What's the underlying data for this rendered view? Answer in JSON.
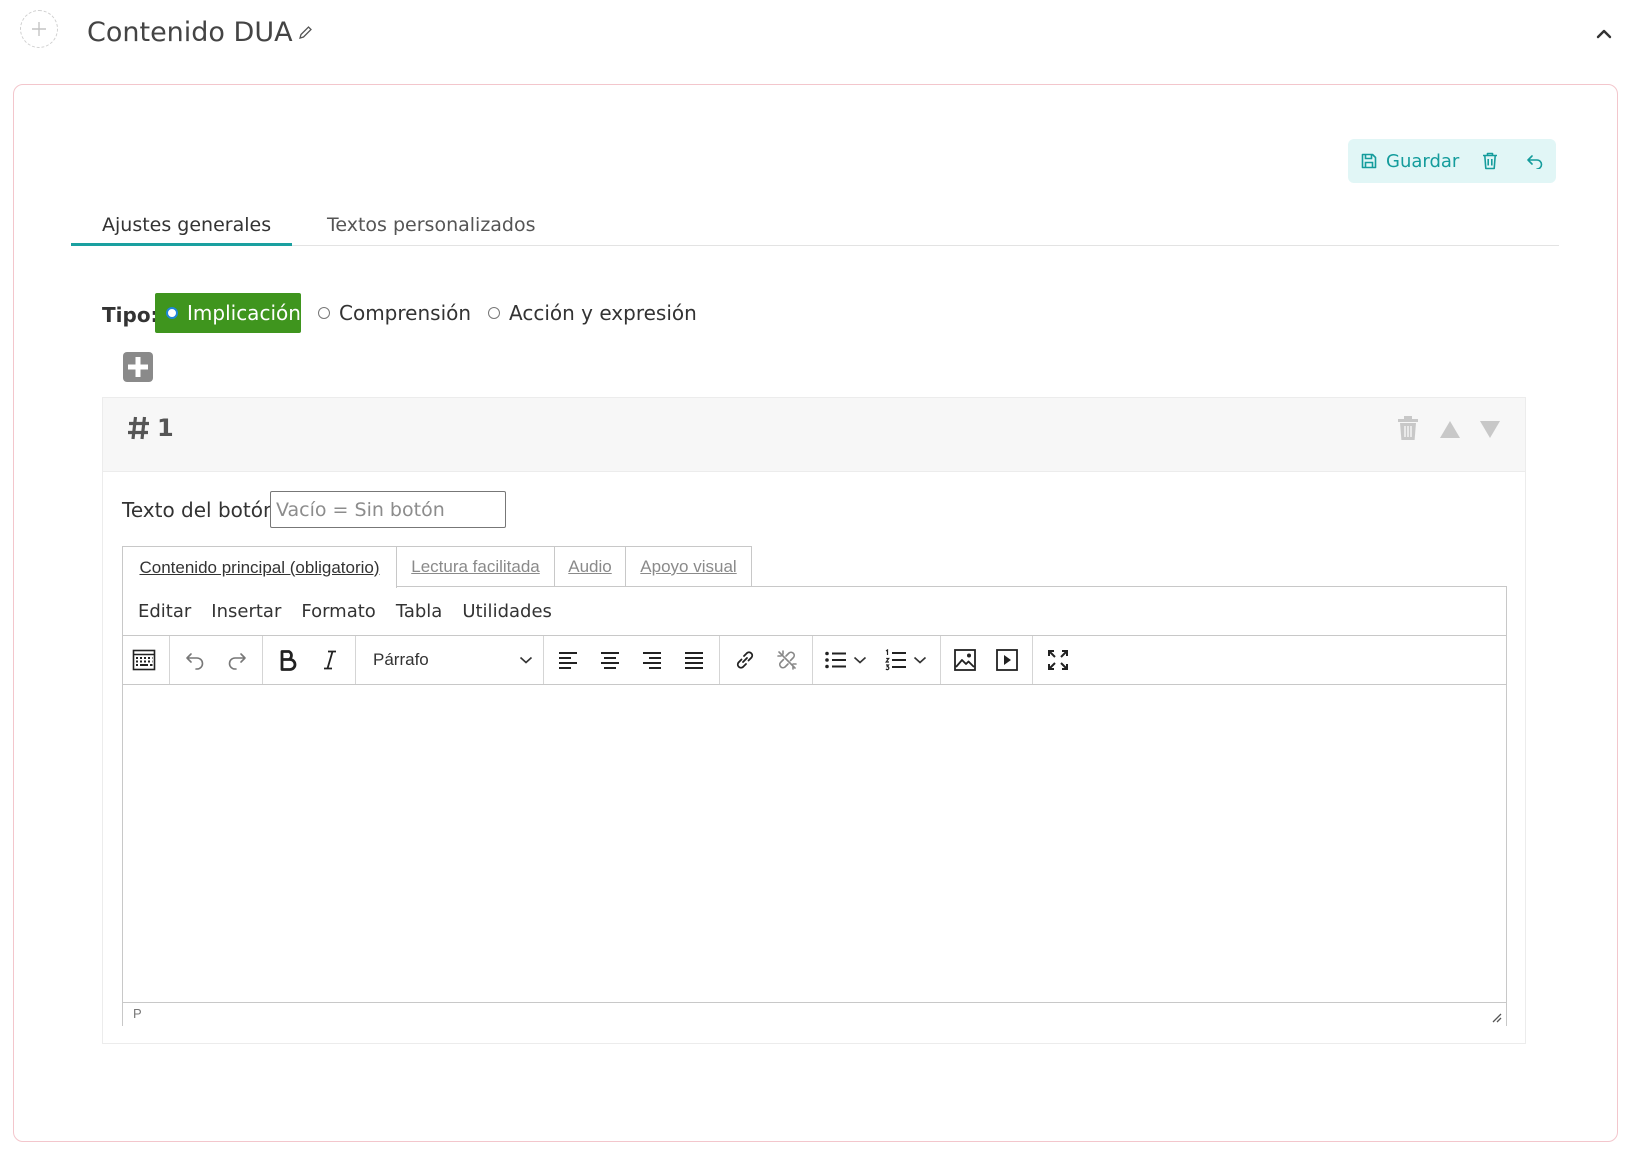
{
  "header": {
    "title": "Contenido DUA"
  },
  "actions": {
    "save_label": "Guardar"
  },
  "tabs": [
    {
      "label": "Ajustes generales",
      "active": true
    },
    {
      "label": "Textos personalizados",
      "active": false
    }
  ],
  "tipo": {
    "label": "Tipo:",
    "options": [
      {
        "label": "Implicación",
        "selected": true
      },
      {
        "label": "Comprensión",
        "selected": false
      },
      {
        "label": "Acción y expresión",
        "selected": false
      }
    ]
  },
  "item": {
    "number": "1",
    "button_text_label": "Texto del botón:",
    "button_text_value": "",
    "button_text_placeholder": "Vacío = Sin botón"
  },
  "content_tabs": [
    {
      "label": "Contenido principal (obligatorio)",
      "active": true
    },
    {
      "label": "Lectura facilitada",
      "active": false
    },
    {
      "label": "Audio",
      "active": false
    },
    {
      "label": "Apoyo visual",
      "active": false
    }
  ],
  "editor": {
    "menu": [
      "Editar",
      "Insertar",
      "Formato",
      "Tabla",
      "Utilidades"
    ],
    "block_format": "Párrafo",
    "status_path": "P"
  },
  "colors": {
    "accent": "#1aa0a0",
    "selected_option": "#3f951e",
    "card_border": "#f3c6cc",
    "action_bar_bg": "#e1f6f6"
  }
}
